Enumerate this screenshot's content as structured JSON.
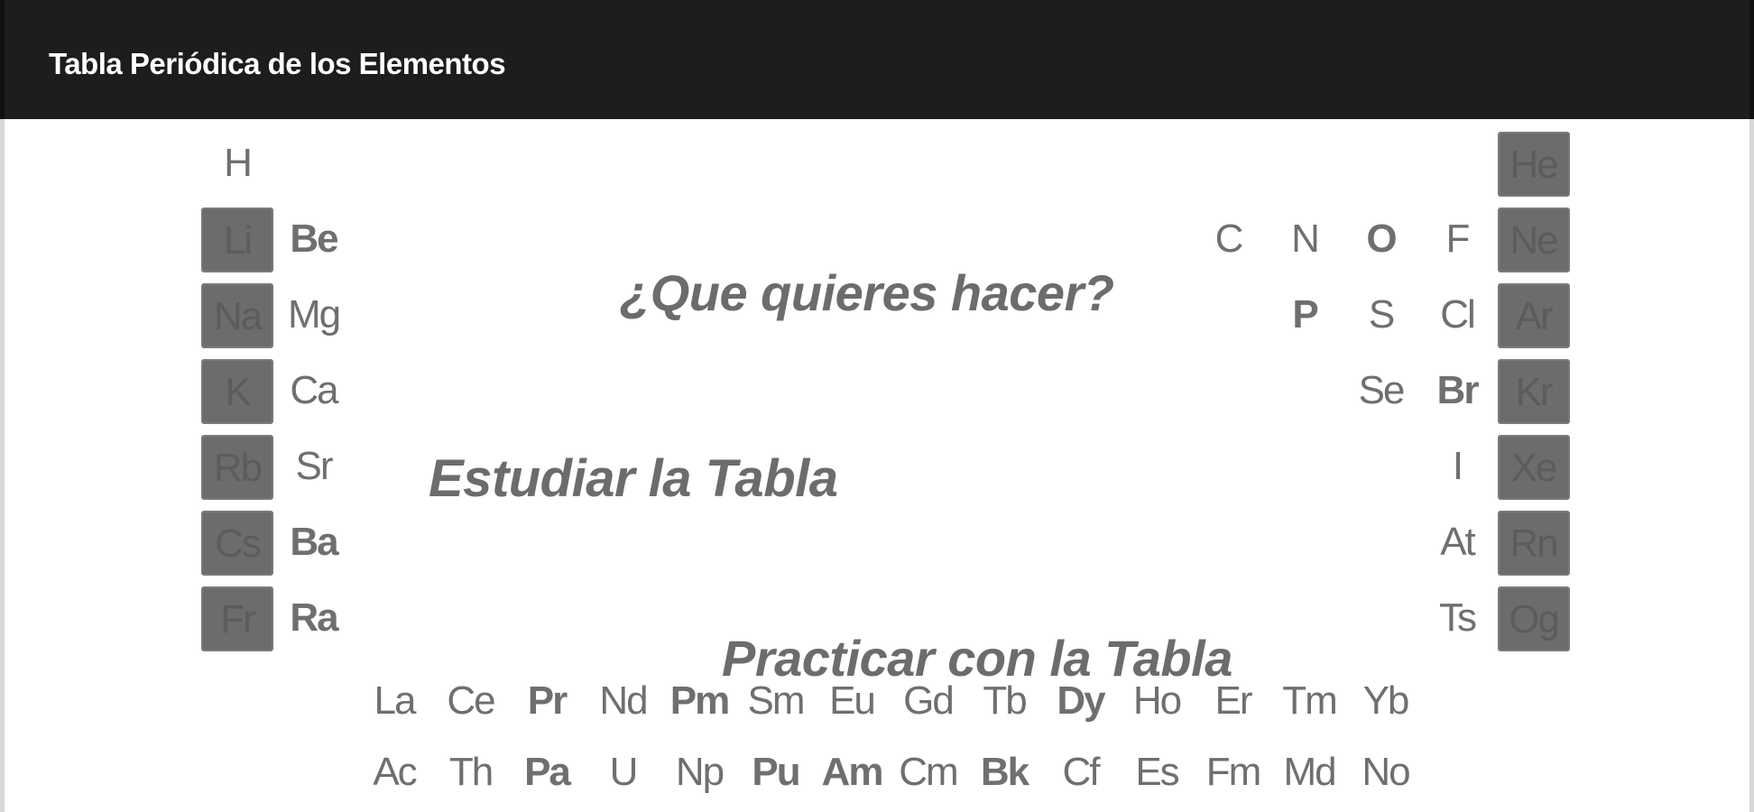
{
  "appbar": {
    "title": "Tabla Periódica de los Elementos"
  },
  "menu": {
    "question": "¿Que quieres hacer?",
    "study": "Estudiar la Tabla",
    "practice": "Practicar con la Tabla"
  },
  "elements": [
    {
      "sym": "H",
      "kind": "plain",
      "row": 0,
      "col": 0
    },
    {
      "sym": "He",
      "kind": "noble",
      "row": 0,
      "col": 17
    },
    {
      "sym": "Li",
      "kind": "alkali",
      "row": 1,
      "col": 0
    },
    {
      "sym": "Be",
      "kind": "bold",
      "row": 1,
      "col": 1
    },
    {
      "sym": "C",
      "kind": "plain",
      "row": 1,
      "col": 13
    },
    {
      "sym": "N",
      "kind": "plain",
      "row": 1,
      "col": 14
    },
    {
      "sym": "O",
      "kind": "bold",
      "row": 1,
      "col": 15
    },
    {
      "sym": "F",
      "kind": "plain",
      "row": 1,
      "col": 16
    },
    {
      "sym": "Ne",
      "kind": "noble",
      "row": 1,
      "col": 17
    },
    {
      "sym": "Na",
      "kind": "alkali",
      "row": 2,
      "col": 0
    },
    {
      "sym": "Mg",
      "kind": "plain",
      "row": 2,
      "col": 1
    },
    {
      "sym": "P",
      "kind": "bold",
      "row": 2,
      "col": 14
    },
    {
      "sym": "S",
      "kind": "plain",
      "row": 2,
      "col": 15
    },
    {
      "sym": "Cl",
      "kind": "plain",
      "row": 2,
      "col": 16
    },
    {
      "sym": "Ar",
      "kind": "noble",
      "row": 2,
      "col": 17
    },
    {
      "sym": "K",
      "kind": "alkali",
      "row": 3,
      "col": 0
    },
    {
      "sym": "Ca",
      "kind": "plain",
      "row": 3,
      "col": 1
    },
    {
      "sym": "Se",
      "kind": "plain",
      "row": 3,
      "col": 15
    },
    {
      "sym": "Br",
      "kind": "bold",
      "row": 3,
      "col": 16
    },
    {
      "sym": "Kr",
      "kind": "noble",
      "row": 3,
      "col": 17
    },
    {
      "sym": "Rb",
      "kind": "alkali",
      "row": 4,
      "col": 0
    },
    {
      "sym": "Sr",
      "kind": "plain",
      "row": 4,
      "col": 1
    },
    {
      "sym": "I",
      "kind": "plain",
      "row": 4,
      "col": 16
    },
    {
      "sym": "Xe",
      "kind": "noble",
      "row": 4,
      "col": 17
    },
    {
      "sym": "Cs",
      "kind": "alkali",
      "row": 5,
      "col": 0
    },
    {
      "sym": "Ba",
      "kind": "bold",
      "row": 5,
      "col": 1
    },
    {
      "sym": "At",
      "kind": "plain",
      "row": 5,
      "col": 16
    },
    {
      "sym": "Rn",
      "kind": "noble",
      "row": 5,
      "col": 17
    },
    {
      "sym": "Fr",
      "kind": "alkali",
      "row": 6,
      "col": 0
    },
    {
      "sym": "Ra",
      "kind": "bold",
      "row": 6,
      "col": 1
    },
    {
      "sym": "Ts",
      "kind": "plain",
      "row": 6,
      "col": 16
    },
    {
      "sym": "Og",
      "kind": "noble",
      "row": 6,
      "col": 17
    }
  ],
  "lanthanides": [
    {
      "sym": "La",
      "kind": "plain"
    },
    {
      "sym": "Ce",
      "kind": "plain"
    },
    {
      "sym": "Pr",
      "kind": "bold"
    },
    {
      "sym": "Nd",
      "kind": "plain"
    },
    {
      "sym": "Pm",
      "kind": "bold"
    },
    {
      "sym": "Sm",
      "kind": "plain"
    },
    {
      "sym": "Eu",
      "kind": "plain"
    },
    {
      "sym": "Gd",
      "kind": "plain"
    },
    {
      "sym": "Tb",
      "kind": "plain"
    },
    {
      "sym": "Dy",
      "kind": "bold"
    },
    {
      "sym": "Ho",
      "kind": "plain"
    },
    {
      "sym": "Er",
      "kind": "plain"
    },
    {
      "sym": "Tm",
      "kind": "plain"
    },
    {
      "sym": "Yb",
      "kind": "plain"
    }
  ],
  "actinides": [
    {
      "sym": "Ac",
      "kind": "plain"
    },
    {
      "sym": "Th",
      "kind": "plain"
    },
    {
      "sym": "Pa",
      "kind": "bold"
    },
    {
      "sym": "U",
      "kind": "plain"
    },
    {
      "sym": "Np",
      "kind": "plain"
    },
    {
      "sym": "Pu",
      "kind": "bold"
    },
    {
      "sym": "Am",
      "kind": "bold"
    },
    {
      "sym": "Cm",
      "kind": "plain"
    },
    {
      "sym": "Bk",
      "kind": "bold"
    },
    {
      "sym": "Cf",
      "kind": "plain"
    },
    {
      "sym": "Es",
      "kind": "plain"
    },
    {
      "sym": "Fm",
      "kind": "plain"
    },
    {
      "sym": "Md",
      "kind": "plain"
    },
    {
      "sym": "No",
      "kind": "plain"
    }
  ]
}
